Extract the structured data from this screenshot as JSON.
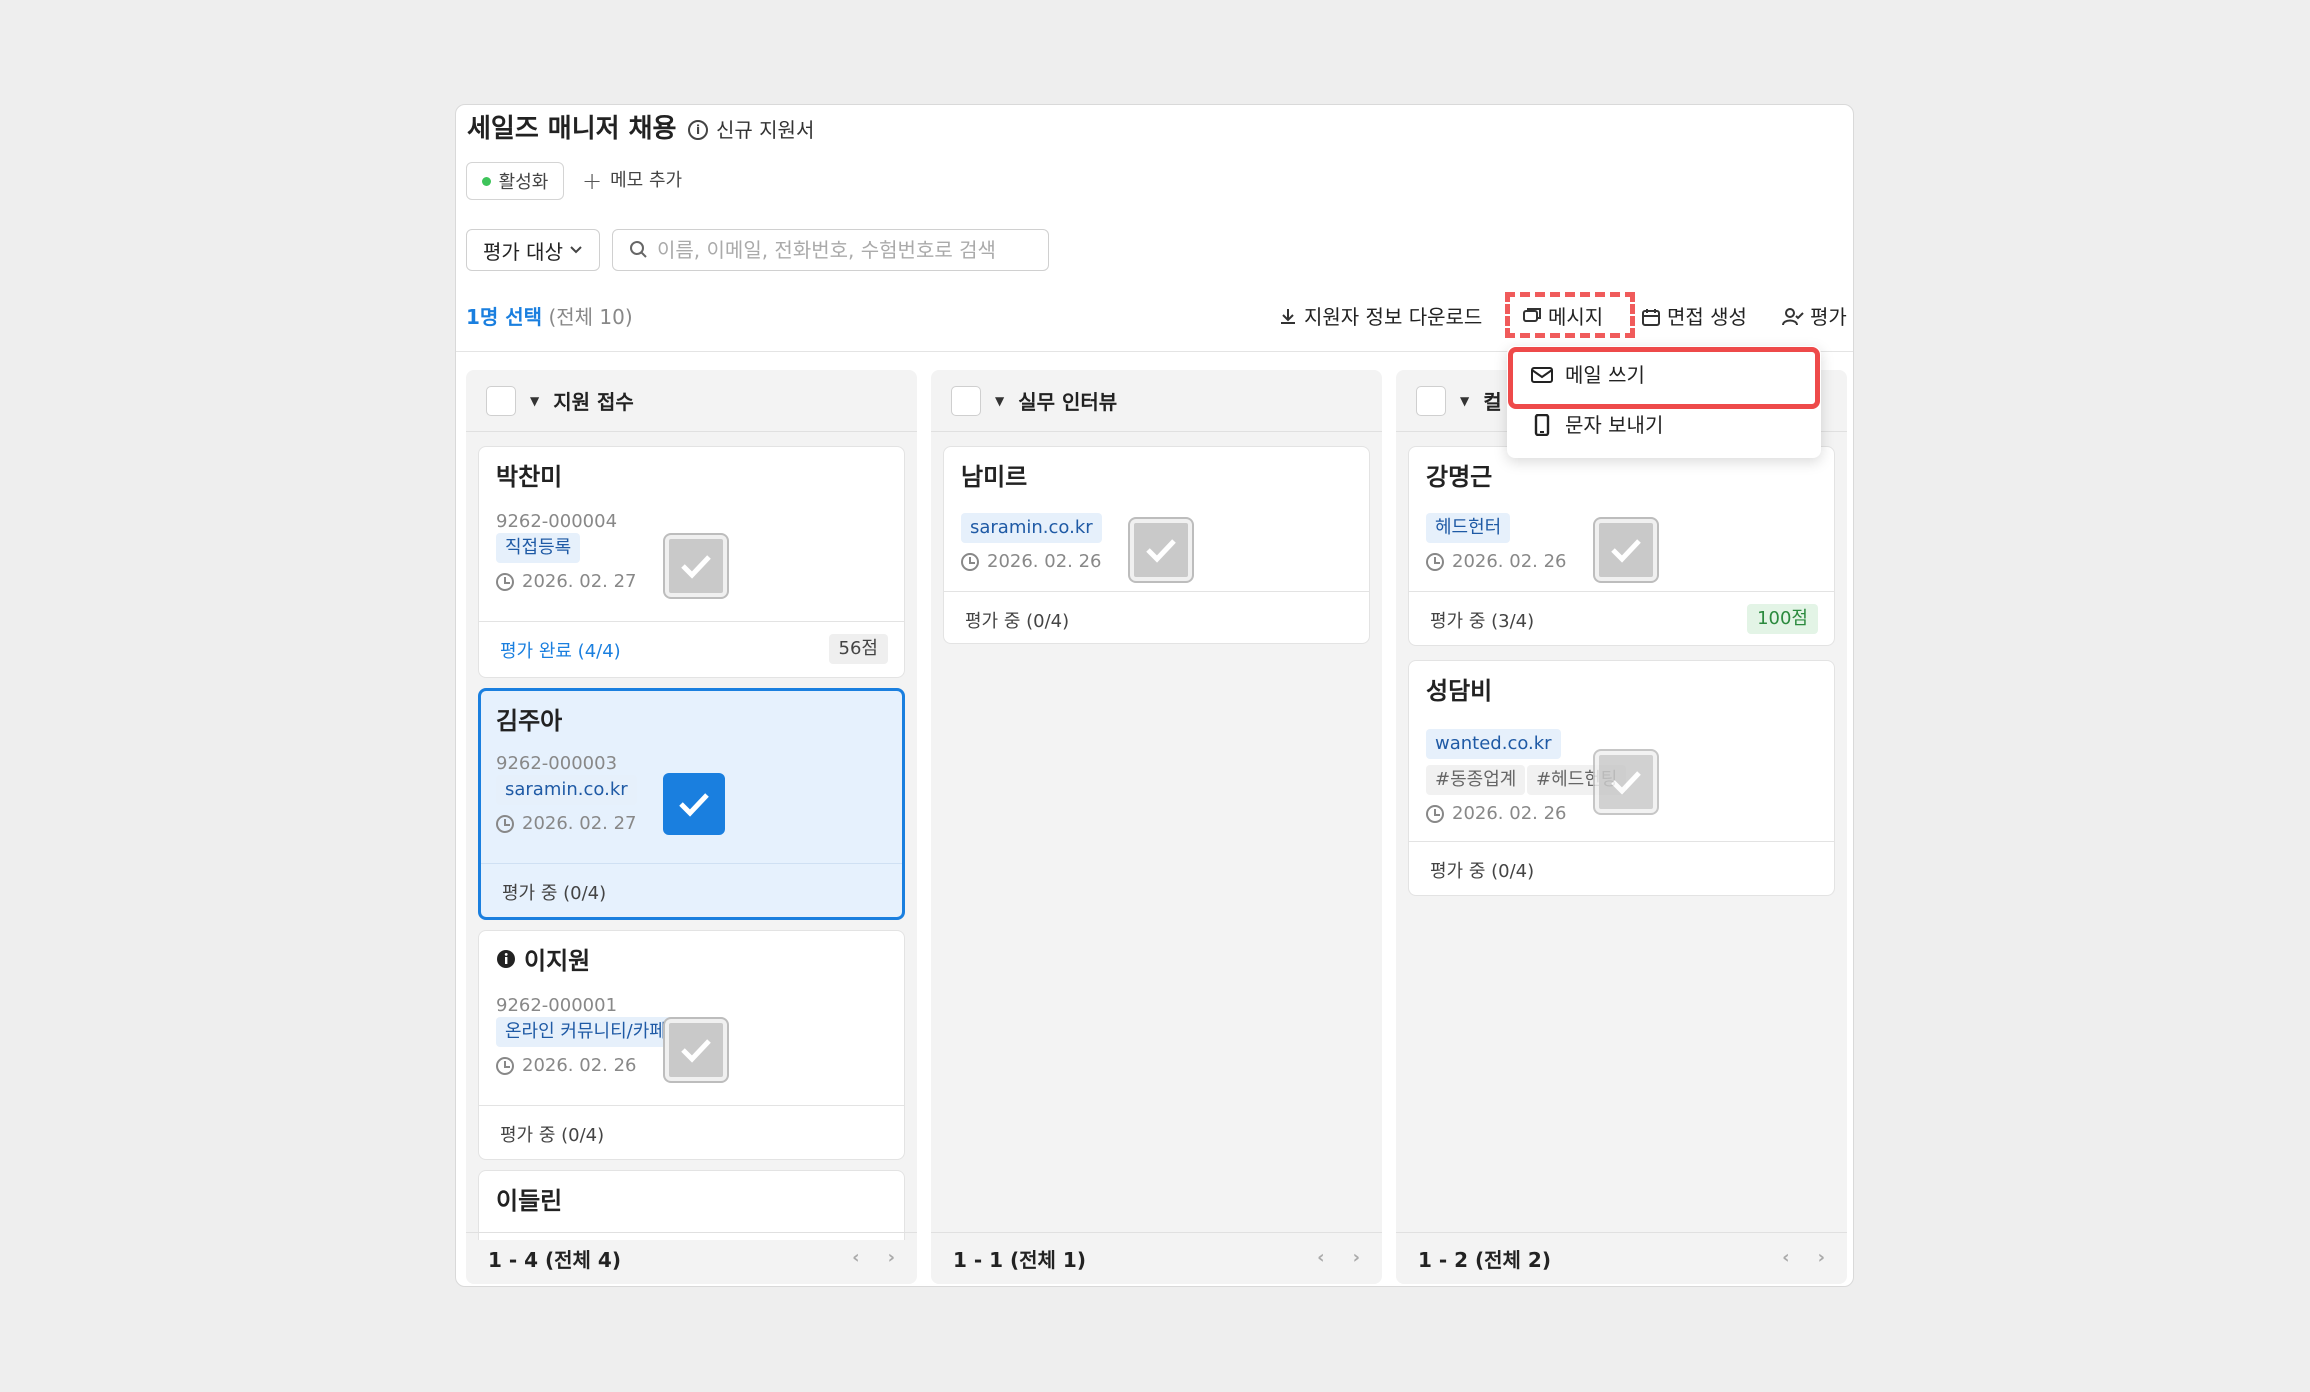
{
  "header": {
    "title": "세일즈 매니저 채용",
    "subtitle": "신규 지원서",
    "status": "활성화",
    "memo_add": "메모 추가"
  },
  "filter": {
    "select_label": "평가 대상",
    "search_placeholder": "이름, 이메일, 전화번호, 수험번호로 검색"
  },
  "selection": {
    "selected": "1명 선택",
    "total": "(전체 10)"
  },
  "toolbar": {
    "download": "지원자 정보 다운로드",
    "message": "메시지",
    "interview": "면접 생성",
    "evaluate": "평가"
  },
  "message_menu": {
    "email": "메일 쓰기",
    "sms": "문자 보내기"
  },
  "columns": [
    {
      "title": "지원 접수",
      "footer": "1 - 4 (전체 4)",
      "cards": [
        {
          "name": "박찬미",
          "id": "9262-000004",
          "tag": "직접등록",
          "date": "2026. 02. 27",
          "status": "평가 완료 (4/4)",
          "score": "56점"
        },
        {
          "name": "김주아",
          "id": "9262-000003",
          "tag": "saramin.co.kr",
          "date": "2026. 02. 27",
          "status": "평가 중 (0/4)"
        },
        {
          "name": "이지원",
          "id": "9262-000001",
          "tag": "온라인 커뮤니티/카페",
          "date": "2026. 02. 26",
          "status": "평가 중 (0/4)"
        },
        {
          "name": "이들린"
        }
      ]
    },
    {
      "title": "실무 인터뷰",
      "footer": "1 - 1 (전체 1)",
      "cards": [
        {
          "name": "남미르",
          "tag": "saramin.co.kr",
          "date": "2026. 02. 26",
          "status": "평가 중 (0/4)"
        }
      ]
    },
    {
      "title": "컬",
      "footer": "1 - 2 (전체 2)",
      "cards": [
        {
          "name": "강명근",
          "tag": "헤드헌터",
          "date": "2026. 02. 26",
          "status": "평가 중 (3/4)",
          "score": "100점"
        },
        {
          "name": "성담비",
          "tag": "wanted.co.kr",
          "tags2": [
            "#동종업계",
            "#헤드헌팅"
          ],
          "date": "2026. 02. 26",
          "status": "평가 중 (0/4)"
        }
      ]
    }
  ],
  "colors": {
    "accent": "#1a7fdf",
    "highlight": "#ee4a4a",
    "active": "#3ec45a"
  }
}
